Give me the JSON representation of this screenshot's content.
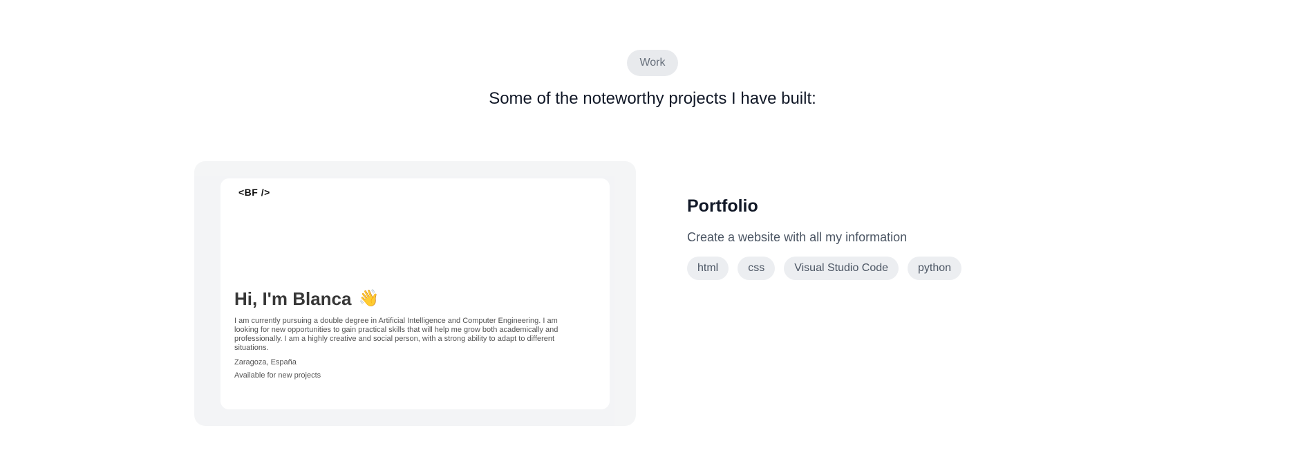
{
  "header": {
    "badge": "Work",
    "subtitle": "Some of the noteworthy projects I have built:"
  },
  "preview": {
    "logo": "<BF />",
    "heading": "Hi, I'm Blanca",
    "wave_emoji": "👋",
    "description": "I am currently pursuing a double degree in Artificial Intelligence and Computer Engineering. I am looking for new opportunities to gain practical skills that will help me grow both academically and professionally. I am a highly creative and social person, with a strong ability to adapt to different situations.",
    "location": "Zaragoza, España",
    "availability": "Available for new projects"
  },
  "project": {
    "title": "Portfolio",
    "description": "Create a website with all my information",
    "tags": [
      "html",
      "css",
      "Visual Studio Code",
      "python"
    ]
  }
}
